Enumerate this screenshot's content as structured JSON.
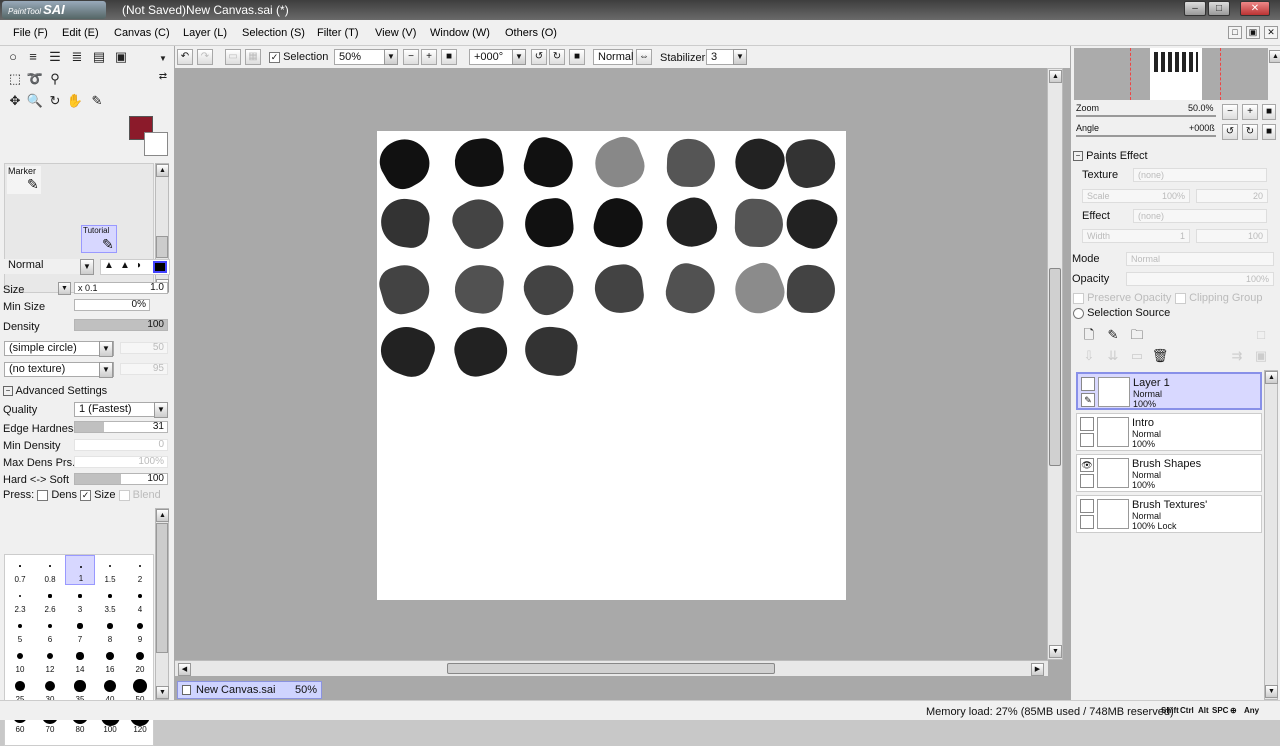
{
  "titlebar": {
    "logo_small": "PaintTool",
    "logo_big": "SAI",
    "title": "(Not Saved)New Canvas.sai (*)"
  },
  "menu": [
    "File (F)",
    "Edit (E)",
    "Canvas (C)",
    "Layer (L)",
    "Selection (S)",
    "Filter (T)",
    "View (V)",
    "Window (W)",
    "Others (O)"
  ],
  "toolbar": {
    "selection_label": "Selection",
    "selection_checked": true,
    "zoom": "50%",
    "rotation": "+000°",
    "blend_mode": "Normal",
    "stabilizer_label": "Stabilizer",
    "stabilizer_value": "3"
  },
  "left": {
    "colors": {
      "primary": "#8b1a2a",
      "secondary": "#ffffff"
    },
    "tools": [
      {
        "name": "Marker"
      },
      {
        "name": "Tutorial"
      }
    ],
    "brush_mode": "Normal",
    "size_label": "Size",
    "size_mult": "x 0.1",
    "size_value": "1.0",
    "min_size_label": "Min Size",
    "min_size_value": "0%",
    "density_label": "Density",
    "density_value": "100",
    "shape": "(simple circle)",
    "shape_val": "50",
    "texture": "(no texture)",
    "texture_val": "95",
    "advanced_label": "Advanced Settings",
    "quality_label": "Quality",
    "quality_value": "1 (Fastest)",
    "edge_label": "Edge Hardness",
    "edge_value": "31",
    "min_density_label": "Min Density",
    "min_density_value": "0",
    "max_dens_label": "Max Dens Prs.",
    "max_dens_value": "100%",
    "hard_soft_label": "Hard <-> Soft",
    "hard_soft_value": "100",
    "press_label": "Press:",
    "dens_label": "Dens",
    "size2_label": "Size",
    "blend_label": "Blend",
    "size_presets": [
      "0.7",
      "0.8",
      "1",
      "1.5",
      "2",
      "2.3",
      "2.6",
      "3",
      "3.5",
      "4",
      "5",
      "6",
      "7",
      "8",
      "9",
      "10",
      "12",
      "14",
      "16",
      "20",
      "25",
      "30",
      "35",
      "40",
      "50",
      "60",
      "70",
      "80",
      "100",
      "120"
    ]
  },
  "right": {
    "zoom_label": "Zoom",
    "zoom_value": "50.0%",
    "angle_label": "Angle",
    "angle_value": "+000ß",
    "paints_effect": "Paints Effect",
    "texture_label": "Texture",
    "texture_value": "(none)",
    "scale_label": "Scale",
    "scale_value": "100%",
    "scale_num": "20",
    "effect_label": "Effect",
    "effect_value": "(none)",
    "width_label": "Width",
    "width_value": "1",
    "width_num": "100",
    "mode_label": "Mode",
    "mode_value": "Normal",
    "opacity_label": "Opacity",
    "opacity_value": "100%",
    "preserve_label": "Preserve Opacity",
    "clipping_label": "Clipping Group",
    "selection_source": "Selection Source",
    "layers": [
      {
        "name": "Layer 1",
        "mode": "Normal",
        "opacity": "100%",
        "lock": "",
        "selected": true
      },
      {
        "name": "Intro",
        "mode": "Normal",
        "opacity": "100%",
        "lock": "",
        "selected": false
      },
      {
        "name": "Brush Shapes",
        "mode": "Normal",
        "opacity": "100%",
        "lock": "",
        "selected": false
      },
      {
        "name": "Brush Textures'",
        "mode": "Normal",
        "opacity": "100%",
        "lock": "Lock",
        "selected": false
      }
    ]
  },
  "doc_tab": {
    "name": "New Canvas.sai",
    "zoom": "50%"
  },
  "status": {
    "memory": "Memory load: 27% (85MB used / 748MB reserved)",
    "keys": [
      "Shift",
      "Ctrl",
      "Alt",
      "SPC",
      "Any"
    ]
  }
}
